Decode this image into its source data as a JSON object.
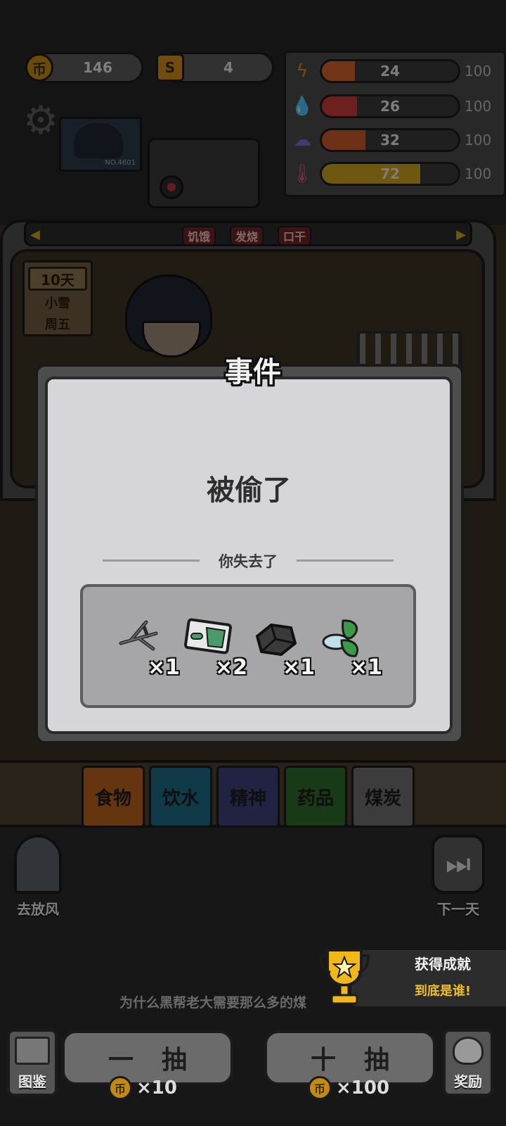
{
  "resources": {
    "coins": "146",
    "tokens": "4",
    "coin_icon": "币",
    "token_icon": "S"
  },
  "stats": [
    {
      "icon": "lightning-icon",
      "value": "24",
      "max": "100",
      "fraction": 0.24,
      "color": "#d0622e"
    },
    {
      "icon": "water-drop-icon",
      "value": "26",
      "max": "100",
      "fraction": 0.26,
      "color": "#c93a3a"
    },
    {
      "icon": "brain-icon",
      "value": "32",
      "max": "100",
      "fraction": 0.32,
      "color": "#c85a2a"
    },
    {
      "icon": "thermometer-icon",
      "value": "72",
      "max": "100",
      "fraction": 0.72,
      "color": "#c8a020"
    }
  ],
  "status_tags": [
    "饥饿",
    "发烧",
    "口干"
  ],
  "day_sign": {
    "day": "10天",
    "weather": "小雪",
    "weekday": "周五"
  },
  "portrait_id": "NO.4601",
  "dialog": {
    "title": "事件",
    "event": "被偷了",
    "lost_label": "你失去了",
    "items": [
      {
        "icon": "twigs-icon",
        "count": "×1"
      },
      {
        "icon": "medicine-box-icon",
        "count": "×2"
      },
      {
        "icon": "coal-icon",
        "count": "×1"
      },
      {
        "icon": "mint-leaf-icon",
        "count": "×1"
      }
    ]
  },
  "tabs": [
    {
      "label": "食物",
      "color": "#b8621e"
    },
    {
      "label": "饮水",
      "color": "#1f6a84"
    },
    {
      "label": "精神",
      "color": "#3e3f7a"
    },
    {
      "label": "药品",
      "color": "#2f6a2a"
    },
    {
      "label": "煤炭",
      "color": "#6e6e6e"
    }
  ],
  "side_buttons": {
    "left": "去放风",
    "right": "下一天"
  },
  "achievement": {
    "title": "获得成就",
    "name": "到底是谁!"
  },
  "ticker": "为什么黑帮老大需要那么多的煤",
  "draw": {
    "single_label": "一抽",
    "single_cost": "×10",
    "ten_label": "十抽",
    "ten_cost": "×100",
    "coin_icon": "币"
  },
  "corner": {
    "left": "图鉴",
    "right": "奖励"
  }
}
